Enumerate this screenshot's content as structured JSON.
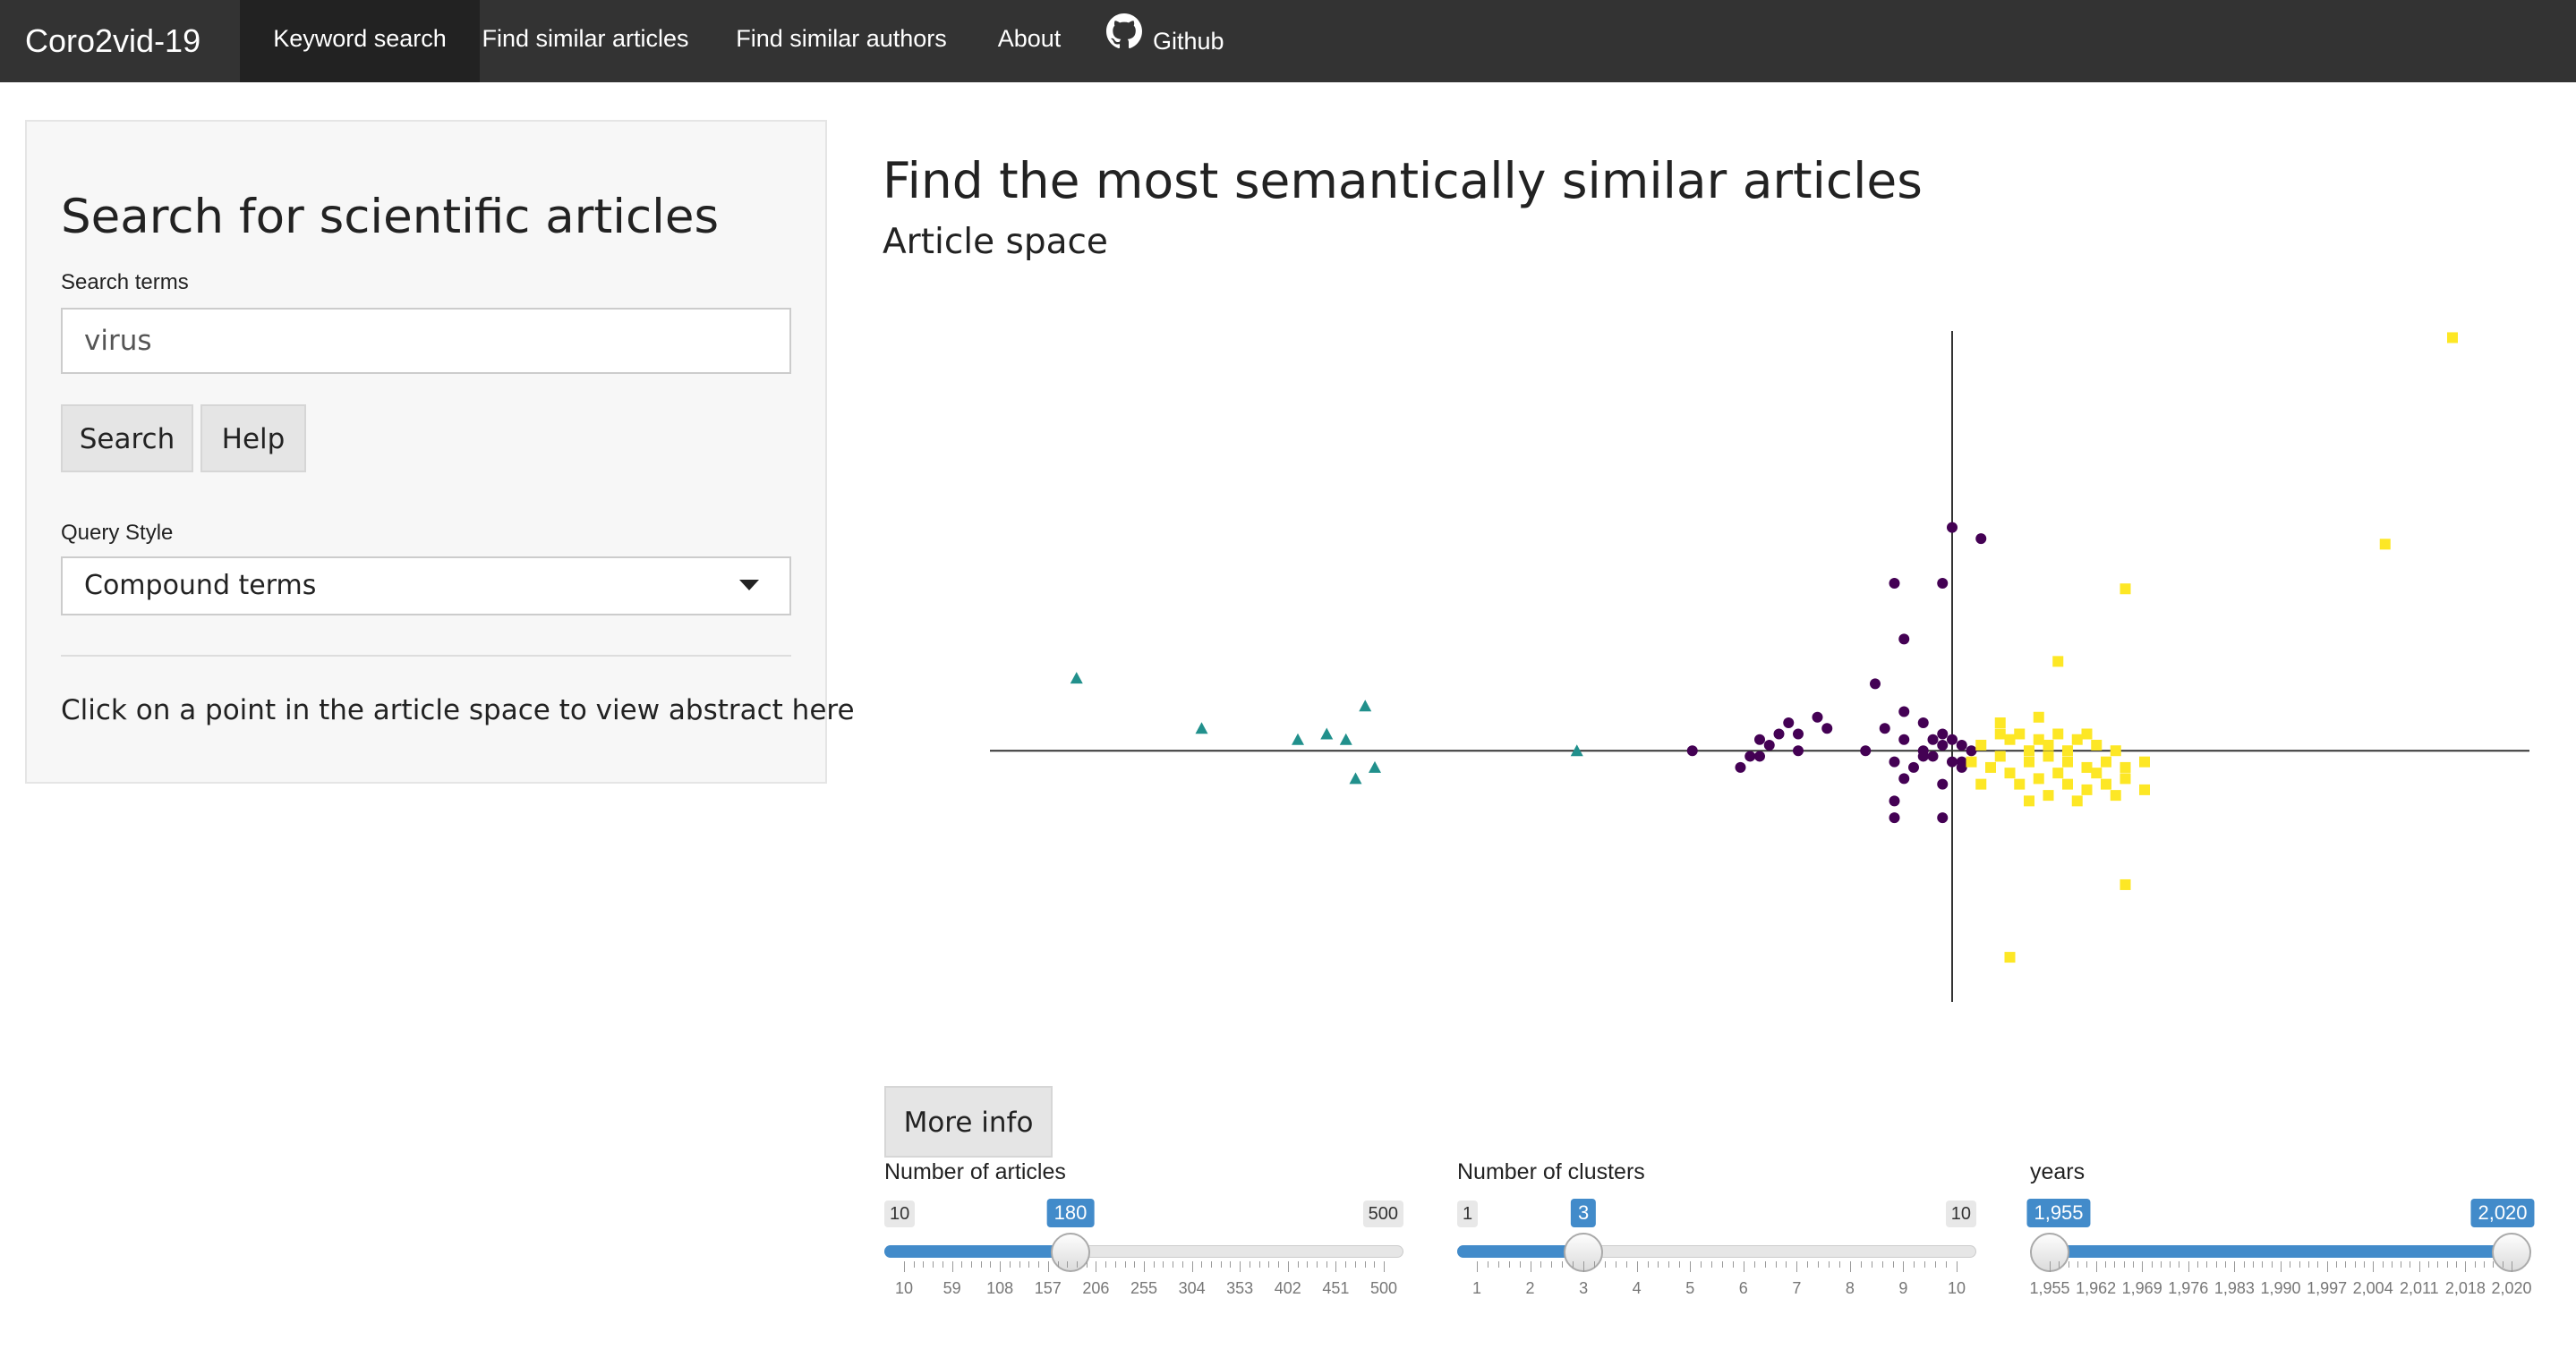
{
  "navbar": {
    "brand": "Coro2vid-19",
    "items": [
      {
        "label": "Keyword search",
        "active": true
      },
      {
        "label": "Find similar articles",
        "active": false
      },
      {
        "label": "Find similar authors",
        "active": false
      },
      {
        "label": "About",
        "active": false
      },
      {
        "label": "Github",
        "icon": "github-icon",
        "active": false
      }
    ]
  },
  "sidebar": {
    "title": "Search for scientific articles",
    "search_label": "Search terms",
    "search_value": "virus",
    "search_button": "Search",
    "help_button": "Help",
    "query_style_label": "Query Style",
    "query_style_value": "Compound terms",
    "hint": "Click on a point in the article space to view abstract here"
  },
  "main": {
    "title": "Find the most semantically similar articles",
    "plot_title": "Article space",
    "more_info_button": "More info"
  },
  "colors": {
    "cluster_1": "#440154",
    "cluster_2": "#21908C",
    "cluster_3": "#FDE725",
    "slider_accent": "#428bca",
    "navbar_bg": "#333333"
  },
  "sliders": [
    {
      "label": "Number of articles",
      "min": 10,
      "max": 500,
      "value": 180,
      "min_label": "10",
      "max_label": "500",
      "value_label": "180",
      "ticks": [
        "10",
        "59",
        "108",
        "157",
        "206",
        "255",
        "304",
        "353",
        "402",
        "451",
        "500"
      ]
    },
    {
      "label": "Number of clusters",
      "min": 1,
      "max": 10,
      "value": 3,
      "min_label": "1",
      "max_label": "10",
      "value_label": "3",
      "ticks": [
        "1",
        "2",
        "3",
        "4",
        "5",
        "6",
        "7",
        "8",
        "9",
        "10"
      ]
    },
    {
      "label": "years",
      "min": 1955,
      "max": 2020,
      "value_low": 1955,
      "value_high": 2020,
      "low_label": "1,955",
      "high_label": "2,020",
      "ticks": [
        "1,955",
        "1,962",
        "1,969",
        "1,976",
        "1,983",
        "1,990",
        "1,997",
        "2,004",
        "2,011",
        "2,018",
        "2,020"
      ]
    }
  ],
  "chart_data": {
    "type": "scatter",
    "title": "Article space",
    "xlabel": "",
    "ylabel": "",
    "xlim": [
      -1.0,
      0.6
    ],
    "ylim": [
      -0.45,
      0.8
    ],
    "grid": false,
    "series": [
      {
        "marker": "circle",
        "color": "#440154",
        "points": [
          [
            0.0,
            0.4
          ],
          [
            0.03,
            0.38
          ],
          [
            -0.06,
            0.3
          ],
          [
            -0.01,
            0.3
          ],
          [
            -0.05,
            0.2
          ],
          [
            -0.08,
            0.12
          ],
          [
            -0.05,
            0.07
          ],
          [
            -0.14,
            0.06
          ],
          [
            -0.17,
            0.05
          ],
          [
            -0.18,
            0.03
          ],
          [
            -0.13,
            0.04
          ],
          [
            -0.16,
            0.03
          ],
          [
            -0.2,
            0.02
          ],
          [
            -0.16,
            0.0
          ],
          [
            -0.19,
            0.01
          ],
          [
            -0.21,
            -0.01
          ],
          [
            -0.22,
            -0.03
          ],
          [
            -0.2,
            -0.01
          ],
          [
            -0.27,
            0.0
          ],
          [
            -0.09,
            0.0
          ],
          [
            -0.07,
            0.04
          ],
          [
            -0.05,
            0.02
          ],
          [
            -0.03,
            0.05
          ],
          [
            -0.06,
            -0.02
          ],
          [
            -0.02,
            -0.01
          ],
          [
            -0.01,
            0.01
          ],
          [
            0.0,
            0.02
          ],
          [
            0.01,
            0.01
          ],
          [
            -0.03,
            0.0
          ],
          [
            -0.02,
            0.02
          ],
          [
            0.0,
            -0.02
          ],
          [
            0.01,
            -0.02
          ],
          [
            -0.01,
            0.03
          ],
          [
            0.02,
            0.0
          ],
          [
            -0.04,
            -0.03
          ],
          [
            -0.05,
            -0.05
          ],
          [
            -0.01,
            -0.06
          ],
          [
            -0.06,
            -0.09
          ],
          [
            -0.01,
            -0.12
          ],
          [
            -0.06,
            -0.12
          ],
          [
            0.01,
            -0.03
          ],
          [
            -0.03,
            -0.01
          ]
        ]
      },
      {
        "marker": "triangle",
        "color": "#21908C",
        "points": [
          [
            -0.91,
            0.13
          ],
          [
            -0.78,
            0.04
          ],
          [
            -0.68,
            0.02
          ],
          [
            -0.65,
            0.03
          ],
          [
            -0.63,
            0.02
          ],
          [
            -0.61,
            0.08
          ],
          [
            -0.62,
            -0.05
          ],
          [
            -0.6,
            -0.03
          ],
          [
            -0.39,
            0.0
          ]
        ]
      },
      {
        "marker": "square",
        "color": "#FDE725",
        "points": [
          [
            0.52,
            0.74
          ],
          [
            0.45,
            0.37
          ],
          [
            0.18,
            0.29
          ],
          [
            0.11,
            0.16
          ],
          [
            0.09,
            0.06
          ],
          [
            0.05,
            0.05
          ],
          [
            0.03,
            0.01
          ],
          [
            0.06,
            0.02
          ],
          [
            0.08,
            0.0
          ],
          [
            0.1,
            -0.01
          ],
          [
            0.12,
            -0.02
          ],
          [
            0.14,
            -0.03
          ],
          [
            0.16,
            -0.02
          ],
          [
            0.18,
            -0.03
          ],
          [
            0.2,
            -0.07
          ],
          [
            0.17,
            0.0
          ],
          [
            0.15,
            0.01
          ],
          [
            0.13,
            0.02
          ],
          [
            0.11,
            0.03
          ],
          [
            0.07,
            0.03
          ],
          [
            0.05,
            -0.01
          ],
          [
            0.04,
            -0.03
          ],
          [
            0.06,
            -0.04
          ],
          [
            0.09,
            -0.05
          ],
          [
            0.12,
            -0.06
          ],
          [
            0.14,
            -0.07
          ],
          [
            0.16,
            -0.06
          ],
          [
            0.18,
            -0.05
          ],
          [
            0.15,
            -0.04
          ],
          [
            0.11,
            -0.04
          ],
          [
            0.08,
            -0.02
          ],
          [
            0.1,
            0.01
          ],
          [
            0.07,
            -0.06
          ],
          [
            0.13,
            -0.09
          ],
          [
            0.17,
            -0.08
          ],
          [
            0.03,
            -0.06
          ],
          [
            0.02,
            -0.02
          ],
          [
            0.09,
            0.02
          ],
          [
            0.12,
            0.0
          ],
          [
            0.18,
            -0.24
          ],
          [
            0.06,
            -0.37
          ],
          [
            0.14,
            0.03
          ],
          [
            0.1,
            -0.08
          ],
          [
            0.05,
            0.03
          ],
          [
            0.08,
            -0.09
          ],
          [
            0.2,
            -0.02
          ]
        ]
      }
    ]
  }
}
